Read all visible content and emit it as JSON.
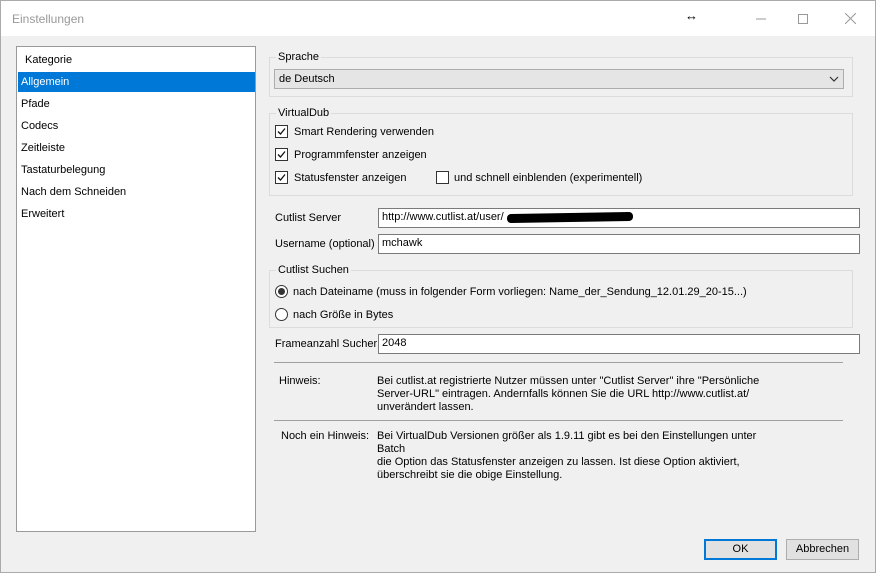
{
  "window": {
    "title": "Einstellungen",
    "resize_glyph": "↔",
    "minimize_glyph": "—",
    "maximize_glyph": "☐",
    "close_glyph": "✕"
  },
  "sidebar": {
    "header": "Kategorie",
    "items": [
      {
        "label": "Allgemein",
        "selected": true
      },
      {
        "label": "Pfade"
      },
      {
        "label": "Codecs"
      },
      {
        "label": "Zeitleiste"
      },
      {
        "label": "Tastaturbelegung"
      },
      {
        "label": "Nach dem Schneiden"
      },
      {
        "label": "Erweitert"
      }
    ]
  },
  "sprache": {
    "group_label": "Sprache",
    "selected": "de Deutsch"
  },
  "virtualdub": {
    "group_label": "VirtualDub",
    "smart_rendering": {
      "label": "Smart Rendering verwenden",
      "checked": true
    },
    "programmfenster": {
      "label": "Programmfenster anzeigen",
      "checked": true
    },
    "statusfenster": {
      "label": "Statusfenster anzeigen",
      "checked": true
    },
    "schnell_einblenden": {
      "label": "und schnell einblenden (experimentell)",
      "checked": false
    }
  },
  "server": {
    "label": "Cutlist Server",
    "value": "http://www.cutlist.at/user/"
  },
  "username": {
    "label": "Username (optional)",
    "value": "mchawk"
  },
  "cutlist_suchen": {
    "group_label": "Cutlist Suchen",
    "by_filename": {
      "label": "nach Dateiname (muss in folgender Form vorliegen:  Name_der_Sendung_12.01.29_20-15...)",
      "selected": true
    },
    "by_size": {
      "label": "nach Größe in Bytes",
      "selected": false
    }
  },
  "frameanzahl": {
    "label": "Frameanzahl Sucher",
    "value": "2048"
  },
  "hinweis": {
    "label": "Hinweis:",
    "line1": "Bei cutlist.at registrierte Nutzer müssen unter \"Cutlist Server\" ihre \"Persönliche",
    "line2": "Server-URL\" eintragen. Andernfalls können Sie die URL http://www.cutlist.at/",
    "line3": "unverändert lassen."
  },
  "hinweis2": {
    "label": "Noch ein Hinweis:",
    "line1": "Bei VirtualDub Versionen größer als 1.9.11 gibt es bei den Einstellungen unter Batch",
    "line2": "die Option das Statusfenster anzeigen zu lassen. Ist diese Option aktiviert,",
    "line3": "überschreibt sie die obige Einstellung."
  },
  "buttons": {
    "ok": "OK",
    "cancel": "Abbrechen"
  },
  "colors": {
    "accent": "#0078d7",
    "window_bg": "#f0f0f0"
  }
}
